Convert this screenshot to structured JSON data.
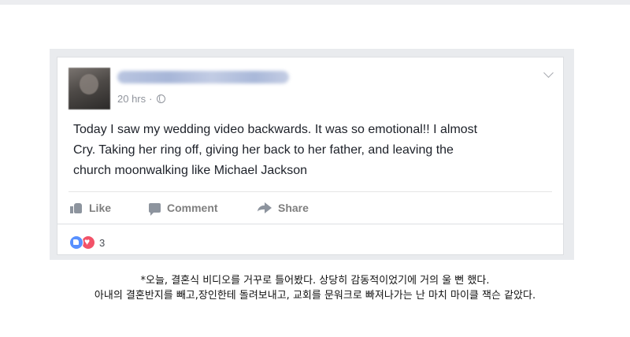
{
  "post": {
    "timestamp": "20 hrs",
    "separator": "·",
    "privacy_icon": "globe-icon",
    "menu_icon": "chevron-down-icon",
    "text": "Today I saw my wedding video backwards. It was so emotional!! I almost\nCry. Taking her ring off, giving her back to her father, and leaving the\nchurch moonwalking like Michael Jackson"
  },
  "actions": {
    "like_label": "Like",
    "comment_label": "Comment",
    "share_label": "Share"
  },
  "reactions": {
    "types": [
      "like",
      "love"
    ],
    "count": "3"
  },
  "caption": {
    "line1": "*오늘, 결혼식 비디오를 거꾸로 틀어봤다. 상당히 감동적이었기에 거의 울 뻔 했다.",
    "line2": "아내의 결혼반지를 빼고,장인한테 돌려보내고, 교회를 문워크로 빠져나가는 난 마치 마이클 잭슨 같았다."
  },
  "colors": {
    "card_background": "#ffffff",
    "frame_background": "#e9ebee",
    "body_text": "#1d2129",
    "muted_text": "#90949c",
    "action_text": "#7f7f7f",
    "like_blue": "#5890ff",
    "love_red": "#f25268"
  }
}
